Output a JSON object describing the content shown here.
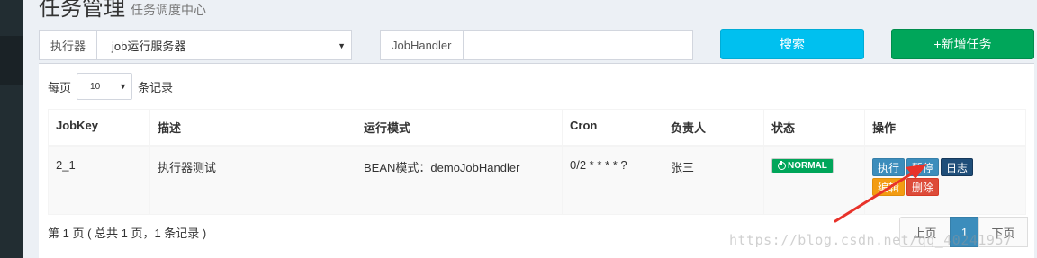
{
  "page": {
    "title": "任务管理",
    "subtitle": "任务调度中心"
  },
  "filters": {
    "executor_label": "执行器",
    "executor_value": "job运行服务器",
    "jobhandler_label": "JobHandler",
    "jobhandler_value": "",
    "search_button": "搜索",
    "add_button": "+新增任务"
  },
  "table_controls": {
    "per_page_prefix": "每页",
    "page_size": "10",
    "per_page_suffix": "条记录"
  },
  "table": {
    "columns": [
      "JobKey",
      "描述",
      "运行模式",
      "Cron",
      "负责人",
      "状态",
      "操作"
    ],
    "rows": [
      {
        "jobkey": "2_1",
        "desc": "执行器测试",
        "mode": "BEAN模式：demoJobHandler",
        "cron": "0/2 * * * * ?",
        "owner": "张三",
        "status": "NORMAL",
        "actions": {
          "run": "执行",
          "pause": "暂停",
          "log": "日志",
          "edit": "编辑",
          "delete": "删除"
        }
      }
    ]
  },
  "footer": {
    "info": "第 1 页 ( 总共 1 页，1 条记录 )",
    "prev": "上页",
    "current": "1",
    "next": "下页"
  },
  "watermark": "https://blog.csdn.net/qq_40241957",
  "colors": {
    "search": "#00c0ef",
    "add": "#00a65a",
    "status_normal": "#00a65a",
    "annotation_arrow": "#e8322a"
  }
}
